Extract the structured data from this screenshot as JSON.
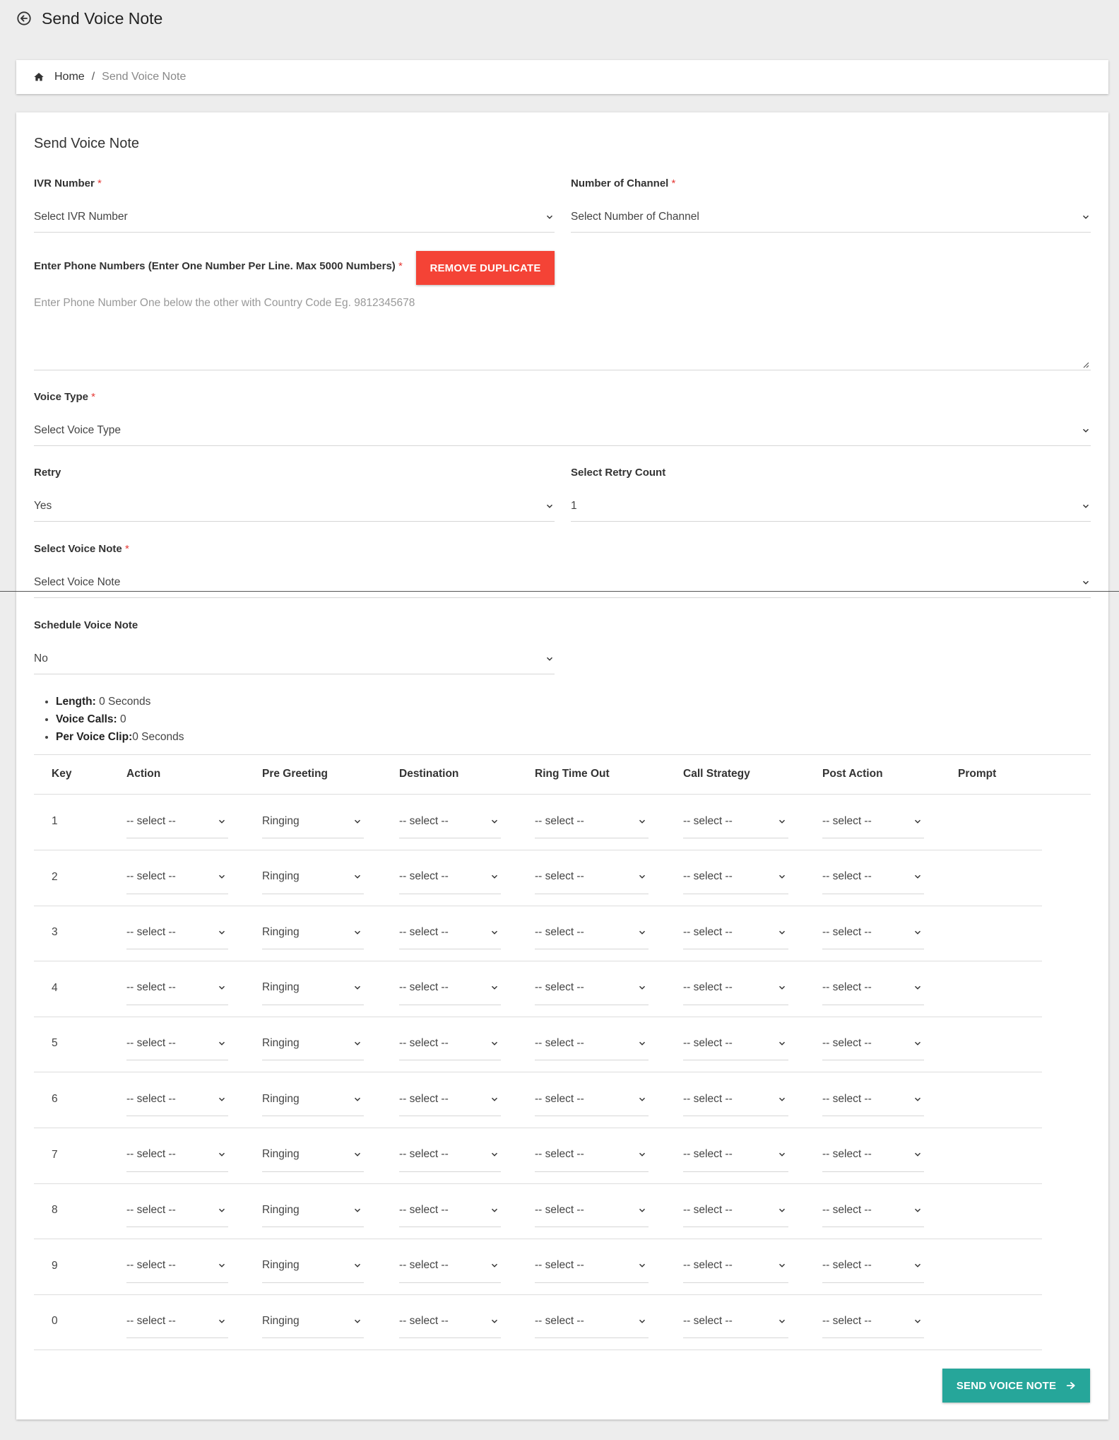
{
  "page": {
    "title": "Send Voice Note"
  },
  "breadcrumb": {
    "home": "Home",
    "separator": "/",
    "current": "Send Voice Note"
  },
  "form": {
    "title": "Send Voice Note",
    "ivr_number": {
      "label": "IVR Number",
      "required": "*",
      "value": "Select IVR Number"
    },
    "channels": {
      "label": "Number of Channel",
      "required": "*",
      "value": "Select Number of Channel"
    },
    "phone_numbers": {
      "label": "Enter Phone Numbers (Enter One Number Per Line. Max 5000 Numbers)",
      "required": "*",
      "placeholder": "Enter Phone Number One below the other with Country Code Eg. 9812345678"
    },
    "remove_duplicate": "REMOVE DUPLICATE",
    "voice_type": {
      "label": "Voice Type",
      "required": "*",
      "value": "Select Voice Type"
    },
    "retry": {
      "label": "Retry",
      "value": "Yes"
    },
    "retry_count": {
      "label": "Select Retry Count",
      "value": "1"
    },
    "voice_note": {
      "label": "Select Voice Note",
      "required": "*",
      "value": "Select Voice Note"
    },
    "schedule": {
      "label": "Schedule Voice Note",
      "value": "No"
    }
  },
  "stats": {
    "length": {
      "label": "Length:",
      "value": " 0 Seconds"
    },
    "voice_calls": {
      "label": "Voice Calls:",
      "value": " 0"
    },
    "per_clip": {
      "label": "Per Voice Clip:",
      "value": "0 Seconds"
    }
  },
  "table": {
    "headers": [
      "Key",
      "Action",
      "Pre Greeting",
      "Destination",
      "Ring Time Out",
      "Call Strategy",
      "Post Action",
      "Prompt"
    ],
    "rows": [
      {
        "key": "1",
        "action": "-- select --",
        "pre_greeting": "Ringing",
        "destination": "-- select --",
        "ring_timeout": "-- select --",
        "call_strategy": "-- select --",
        "post_action": "-- select --"
      },
      {
        "key": "2",
        "action": "-- select --",
        "pre_greeting": "Ringing",
        "destination": "-- select --",
        "ring_timeout": "-- select --",
        "call_strategy": "-- select --",
        "post_action": "-- select --"
      },
      {
        "key": "3",
        "action": "-- select --",
        "pre_greeting": "Ringing",
        "destination": "-- select --",
        "ring_timeout": "-- select --",
        "call_strategy": "-- select --",
        "post_action": "-- select --"
      },
      {
        "key": "4",
        "action": "-- select --",
        "pre_greeting": "Ringing",
        "destination": "-- select --",
        "ring_timeout": "-- select --",
        "call_strategy": "-- select --",
        "post_action": "-- select --"
      },
      {
        "key": "5",
        "action": "-- select --",
        "pre_greeting": "Ringing",
        "destination": "-- select --",
        "ring_timeout": "-- select --",
        "call_strategy": "-- select --",
        "post_action": "-- select --"
      },
      {
        "key": "6",
        "action": "-- select --",
        "pre_greeting": "Ringing",
        "destination": "-- select --",
        "ring_timeout": "-- select --",
        "call_strategy": "-- select --",
        "post_action": "-- select --"
      },
      {
        "key": "7",
        "action": "-- select --",
        "pre_greeting": "Ringing",
        "destination": "-- select --",
        "ring_timeout": "-- select --",
        "call_strategy": "-- select --",
        "post_action": "-- select --"
      },
      {
        "key": "8",
        "action": "-- select --",
        "pre_greeting": "Ringing",
        "destination": "-- select --",
        "ring_timeout": "-- select --",
        "call_strategy": "-- select --",
        "post_action": "-- select --"
      },
      {
        "key": "9",
        "action": "-- select --",
        "pre_greeting": "Ringing",
        "destination": "-- select --",
        "ring_timeout": "-- select --",
        "call_strategy": "-- select --",
        "post_action": "-- select --"
      },
      {
        "key": "0",
        "action": "-- select --",
        "pre_greeting": "Ringing",
        "destination": "-- select --",
        "ring_timeout": "-- select --",
        "call_strategy": "-- select --",
        "post_action": "-- select --"
      }
    ]
  },
  "submit": {
    "label": "SEND VOICE NOTE"
  },
  "colors": {
    "danger": "#f44336",
    "primary": "#26a69a",
    "background": "#ededed"
  },
  "icons": {
    "back": "arrow-left-circle-icon",
    "home": "home-icon",
    "chevron": "chevron-down-icon",
    "submit": "arrow-right-icon"
  }
}
